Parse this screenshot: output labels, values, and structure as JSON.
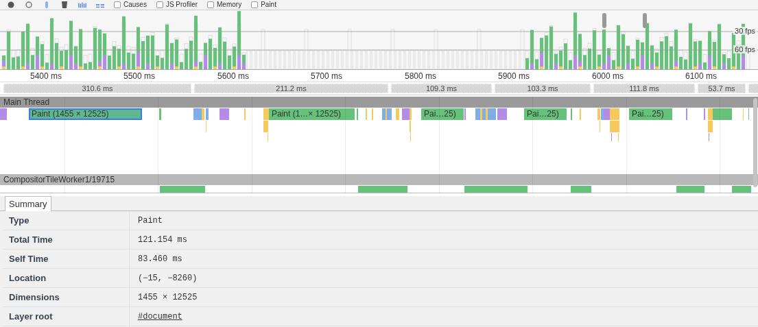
{
  "toolbar": {
    "checkboxes": [
      {
        "label": "Causes",
        "checked": false
      },
      {
        "label": "JS Profiler",
        "checked": false
      },
      {
        "label": "Memory",
        "checked": false
      },
      {
        "label": "Paint",
        "checked": false
      }
    ]
  },
  "overview": {
    "fps_labels": [
      "30 fps",
      "60 fps"
    ]
  },
  "ruler": {
    "ticks": [
      "5400 ms",
      "5500 ms",
      "5600 ms",
      "5700 ms",
      "5800 ms",
      "5900 ms",
      "6000 ms",
      "6100 ms"
    ]
  },
  "frames": [
    "310.6 ms",
    "211.2 ms",
    "109.3 ms",
    "103.3 ms",
    "111.8 ms",
    "53.7 ms"
  ],
  "tracks": [
    {
      "title": "Main Thread",
      "events": [
        {
          "label": "Paint (1455 × 12525)",
          "selected": true
        },
        {
          "label": "Paint (1…× 12525)",
          "selected": false
        },
        {
          "label": "Pai…25)",
          "selected": false
        },
        {
          "label": "Pai…25)",
          "selected": false
        },
        {
          "label": "Pai…25)",
          "selected": false
        }
      ]
    },
    {
      "title": "CompositorTileWorker1/19715"
    }
  ],
  "details": {
    "tabs": [
      {
        "label": "Summary",
        "selected": true
      }
    ],
    "rows": [
      {
        "label": "Type",
        "value": "Paint",
        "kind": "text"
      },
      {
        "label": "Total Time",
        "value": "121.154 ms",
        "kind": "text"
      },
      {
        "label": "Self Time",
        "value": "83.460 ms",
        "kind": "text"
      },
      {
        "label": "Location",
        "value": "(−15, −8260)",
        "kind": "text"
      },
      {
        "label": "Dimensions",
        "value": "1455 × 12525",
        "kind": "text"
      },
      {
        "label": "Layer root",
        "value": "#document",
        "kind": "link"
      }
    ]
  }
}
